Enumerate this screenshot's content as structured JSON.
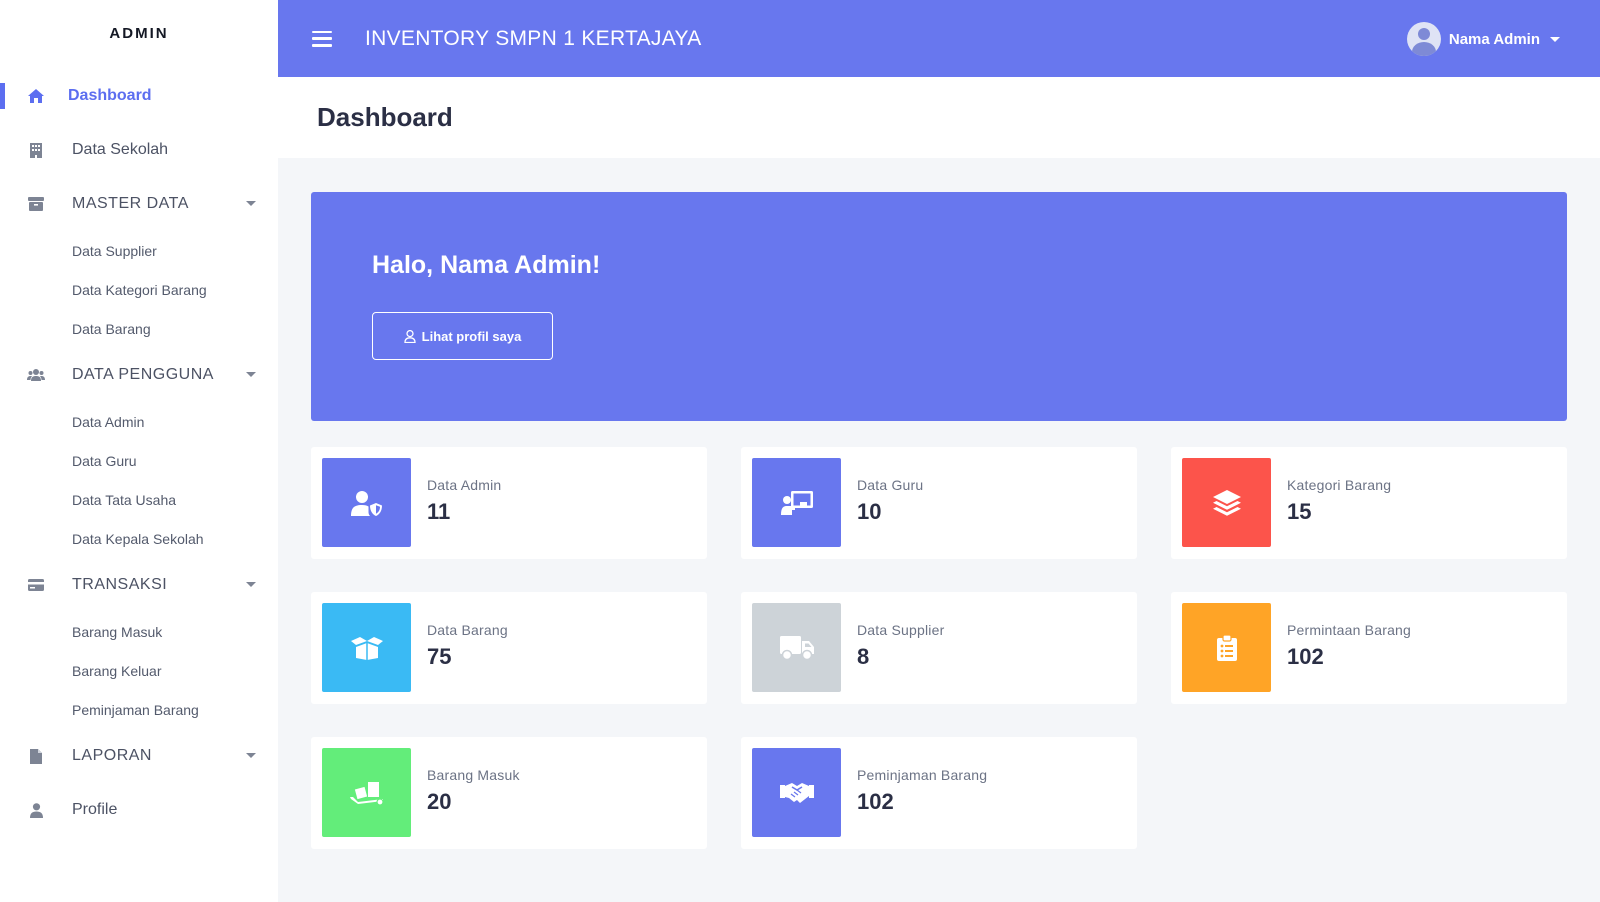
{
  "sidebar": {
    "brand": "ADMIN",
    "items": [
      {
        "label": "Dashboard",
        "icon": "home-icon"
      },
      {
        "label": "Data Sekolah",
        "icon": "building-icon"
      },
      {
        "label": "MASTER DATA",
        "icon": "archive-icon",
        "children": [
          "Data Supplier",
          "Data Kategori Barang",
          "Data Barang"
        ]
      },
      {
        "label": "DATA PENGGUNA",
        "icon": "users-icon",
        "children": [
          "Data Admin",
          "Data Guru",
          "Data Tata Usaha",
          "Data Kepala Sekolah"
        ]
      },
      {
        "label": "TRANSAKSI",
        "icon": "credit-card-icon",
        "children": [
          "Barang Masuk",
          "Barang Keluar",
          "Peminjaman Barang"
        ]
      },
      {
        "label": "LAPORAN",
        "icon": "file-icon"
      },
      {
        "label": "Profile",
        "icon": "user-icon"
      }
    ]
  },
  "topbar": {
    "title": "INVENTORY SMPN 1 KERTAJAYA",
    "user_name": "Nama Admin"
  },
  "page": {
    "title": "Dashboard"
  },
  "hero": {
    "greeting": "Halo, Nama Admin!",
    "button_label": "Lihat profil saya"
  },
  "stats": [
    {
      "label": "Data Admin",
      "value": "11",
      "color": "#6877ee",
      "icon": "user-shield-icon"
    },
    {
      "label": "Data Guru",
      "value": "10",
      "color": "#6877ee",
      "icon": "chalkboard-teacher-icon"
    },
    {
      "label": "Kategori Barang",
      "value": "15",
      "color": "#fc544b",
      "icon": "layers-icon"
    },
    {
      "label": "Data Barang",
      "value": "75",
      "color": "#3abaf4",
      "icon": "box-open-icon"
    },
    {
      "label": "Data Supplier",
      "value": "8",
      "color": "#cdd3d8",
      "icon": "truck-icon"
    },
    {
      "label": "Permintaan Barang",
      "value": "102",
      "color": "#ffa426",
      "icon": "clipboard-list-icon"
    },
    {
      "label": "Barang Masuk",
      "value": "20",
      "color": "#63ed7a",
      "icon": "dolly-icon"
    },
    {
      "label": "Peminjaman Barang",
      "value": "102",
      "color": "#6877ee",
      "icon": "handshake-icon"
    }
  ]
}
